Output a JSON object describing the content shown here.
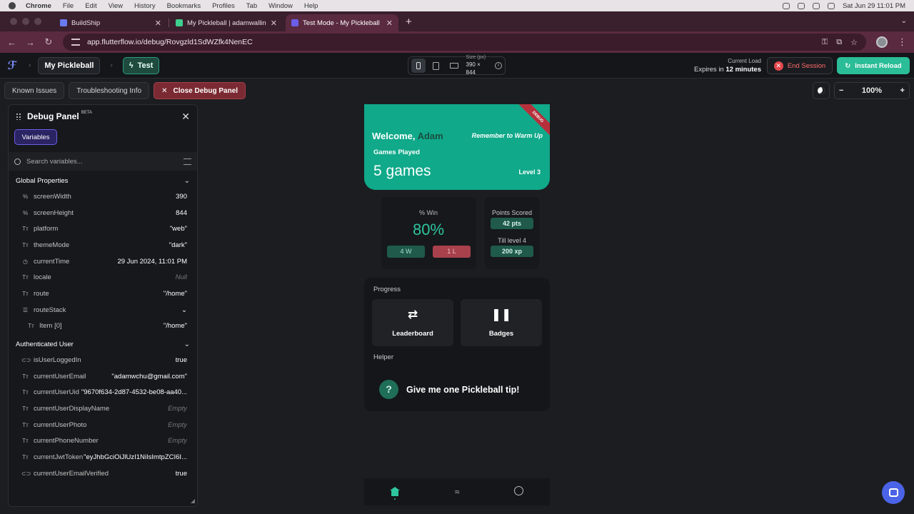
{
  "macbar": {
    "app": "Chrome",
    "menus": [
      "File",
      "Edit",
      "View",
      "History",
      "Bookmarks",
      "Profiles",
      "Tab",
      "Window",
      "Help"
    ],
    "clock": "Sat Jun 29  11:01 PM"
  },
  "browser": {
    "tabs": [
      {
        "title": "BuildShip",
        "color": "#6a7bf0",
        "active": false
      },
      {
        "title": "My Pickleball | adamwallinc@",
        "color": "#3ecf8e",
        "active": false
      },
      {
        "title": "Test Mode - My Pickleball",
        "color": "#6b5ee8",
        "active": true
      }
    ],
    "url": "app.flutterflow.io/debug/Rovgzld1SdWZfk4NenEC"
  },
  "ffheader": {
    "project": "My Pickleball",
    "mode": "Test",
    "size_label": "Size (px)",
    "size_value": "390 × 844",
    "load_label": "Current Load",
    "expires_prefix": "Expires in",
    "expires_value": "12 minutes",
    "end_session": "End Session",
    "instant_reload": "Instant Reload"
  },
  "toolbar": {
    "known_issues": "Known Issues",
    "troubleshooting": "Troubleshooting Info",
    "close_debug": "Close Debug Panel",
    "zoom": "100%"
  },
  "debug_panel": {
    "title": "Debug Panel",
    "beta": "BETA",
    "variables_tab": "Variables",
    "search_placeholder": "Search variables...",
    "global_title": "Global Properties",
    "global": [
      {
        "icon": "%",
        "name": "screenWidth",
        "value": "390",
        "muted": false
      },
      {
        "icon": "%",
        "name": "screenHeight",
        "value": "844",
        "muted": false
      },
      {
        "icon": "Tт",
        "name": "platform",
        "value": "\"web\"",
        "muted": false
      },
      {
        "icon": "Tт",
        "name": "themeMode",
        "value": "\"dark\"",
        "muted": false
      },
      {
        "icon": "◷",
        "name": "currentTime",
        "value": "29 Jun 2024, 11:01 PM",
        "muted": false
      },
      {
        "icon": "Tт",
        "name": "locale",
        "value": "Null",
        "muted": true
      },
      {
        "icon": "Tт",
        "name": "route",
        "value": "\"/home\"",
        "muted": false
      },
      {
        "icon": "☰",
        "name": "routeStack",
        "value": "",
        "muted": false
      }
    ],
    "route_item": {
      "icon": "Tт",
      "name": "Item [0]",
      "value": "\"/home\""
    },
    "auth_title": "Authenticated User",
    "auth": [
      {
        "icon": "⊂⊃",
        "name": "isUserLoggedIn",
        "value": "true",
        "muted": false
      },
      {
        "icon": "Tт",
        "name": "currentUserEmail",
        "value": "\"adamwchu@gmail.com\"",
        "muted": false
      },
      {
        "icon": "Tт",
        "name": "currentUserUid",
        "value": "\"9670f634-2d87-4532-be08-aa40...",
        "muted": false
      },
      {
        "icon": "Tт",
        "name": "currentUserDisplayName",
        "value": "Empty",
        "muted": true
      },
      {
        "icon": "Tт",
        "name": "currentUserPhoto",
        "value": "Empty",
        "muted": true
      },
      {
        "icon": "Tт",
        "name": "currentPhoneNumber",
        "value": "Empty",
        "muted": true
      },
      {
        "icon": "Tт",
        "name": "currentJwtToken",
        "value": "\"eyJhbGciOiJlUzI1NiIsImtpZCI6I...",
        "muted": false
      },
      {
        "icon": "⊂⊃",
        "name": "currentUserEmailVerified",
        "value": "true",
        "muted": false
      }
    ]
  },
  "app": {
    "debug_ribbon": "DEBUG",
    "welcome": "Welcome,",
    "user": "Adam",
    "warmup": "Remember to Warm Up",
    "games_label": "Games Played",
    "games_value": "5 games",
    "level": "Level 3",
    "win_label": "% Win",
    "win_value": "80%",
    "wins": "4 W",
    "losses": "1 L",
    "points_label": "Points Scored",
    "points_value": "42 pts",
    "till_label": "Till level 4",
    "till_value": "200 xp",
    "progress_title": "Progress",
    "leaderboard": "Leaderboard",
    "badges": "Badges",
    "helper_title": "Helper",
    "tip": "Give me one Pickleball tip!"
  }
}
